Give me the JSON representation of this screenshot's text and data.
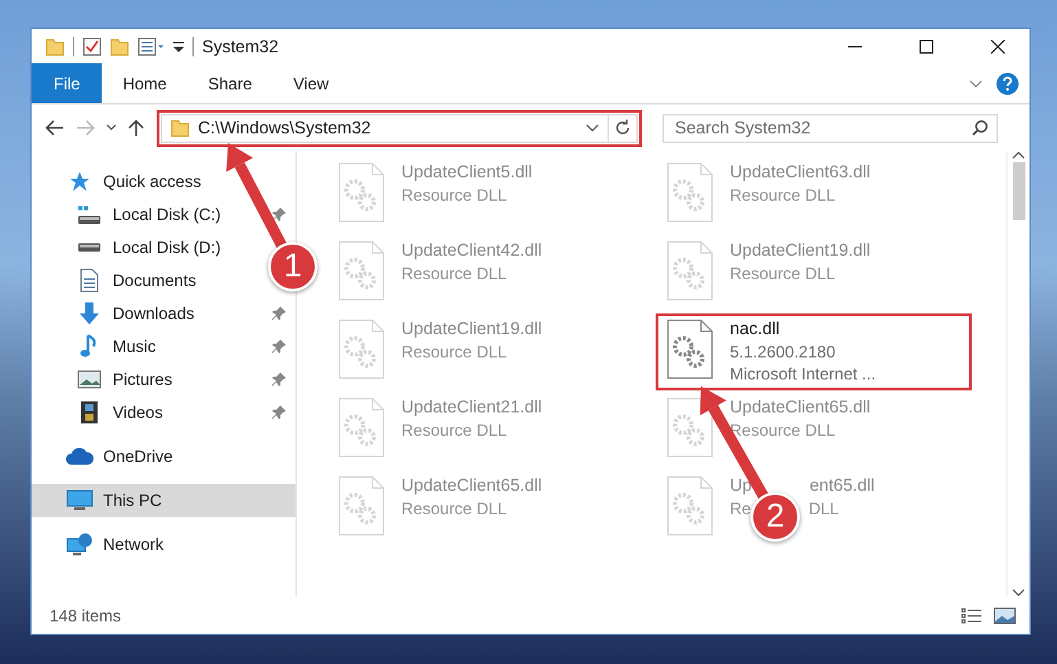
{
  "window": {
    "title": "System32"
  },
  "ribbon": {
    "tabs": [
      {
        "label": "File",
        "kind": "file"
      },
      {
        "label": "Home",
        "kind": "tab"
      },
      {
        "label": "Share",
        "kind": "tab"
      },
      {
        "label": "View",
        "kind": "tab"
      }
    ]
  },
  "address": {
    "path": "C:\\Windows\\System32",
    "highlighted": true
  },
  "search": {
    "placeholder": "Search System32"
  },
  "nav": [
    {
      "label": "Quick access",
      "kind": "star",
      "selected": false,
      "children": [
        {
          "label": "Local Disk (C:)",
          "kind": "drive-c",
          "pinned": true,
          "selected": false
        },
        {
          "label": "Local Disk (D:)",
          "kind": "drive",
          "pinned": false,
          "selected": false
        },
        {
          "label": "Documents",
          "kind": "documents",
          "pinned": false,
          "selected": false
        },
        {
          "label": "Downloads",
          "kind": "downloads",
          "pinned": true,
          "selected": false
        },
        {
          "label": "Music",
          "kind": "music",
          "pinned": true,
          "selected": false
        },
        {
          "label": "Pictures",
          "kind": "pictures",
          "pinned": true,
          "selected": false
        },
        {
          "label": "Videos",
          "kind": "videos",
          "pinned": true,
          "selected": false
        }
      ]
    },
    {
      "label": "OneDrive",
      "kind": "cloud",
      "selected": false
    },
    {
      "label": "This PC",
      "kind": "pc",
      "selected": true
    },
    {
      "label": "Network",
      "kind": "network",
      "selected": false
    }
  ],
  "files": [
    {
      "name": "UpdateClient5.dll",
      "details": [
        "Resource DLL"
      ],
      "dimmed": true,
      "highlighted": false
    },
    {
      "name": "UpdateClient63.dll",
      "details": [
        "Resource DLL"
      ],
      "dimmed": true,
      "highlighted": false
    },
    {
      "name": "UpdateClient42.dll",
      "details": [
        "Resource DLL"
      ],
      "dimmed": true,
      "highlighted": false
    },
    {
      "name": "UpdateClient19.dll",
      "details": [
        "Resource DLL"
      ],
      "dimmed": true,
      "highlighted": false
    },
    {
      "name": "UpdateClient19.dll",
      "details": [
        "Resource DLL"
      ],
      "dimmed": true,
      "highlighted": false
    },
    {
      "name": "nac.dll",
      "details": [
        "5.1.2600.2180",
        "Microsoft Internet ..."
      ],
      "dimmed": false,
      "highlighted": true
    },
    {
      "name": "UpdateClient21.dll",
      "details": [
        "Resource DLL"
      ],
      "dimmed": true,
      "highlighted": false
    },
    {
      "name": "UpdateClient65.dll",
      "details": [
        "Resource DLL"
      ],
      "dimmed": true,
      "highlighted": false
    },
    {
      "name": "UpdateClient65.dll",
      "details": [
        "Resource DLL"
      ],
      "dimmed": true,
      "highlighted": false
    },
    {
      "name_parts": [
        "Up",
        "ent65.dll"
      ],
      "detail_parts": [
        "Re",
        "DLL"
      ],
      "dimmed": true,
      "highlighted": false
    }
  ],
  "status_bar": {
    "count": "148 items"
  },
  "annotations": [
    {
      "number": "1"
    },
    {
      "number": "2"
    }
  ]
}
